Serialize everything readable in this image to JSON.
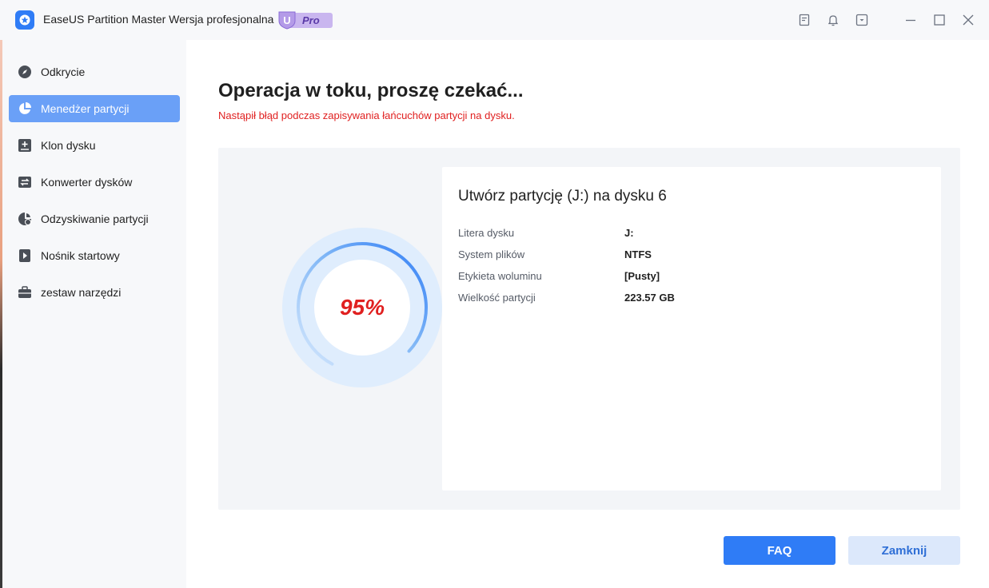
{
  "window": {
    "title": "EaseUS Partition Master Wersja profesjonalna",
    "badge_letter": "U",
    "badge_label": "Pro",
    "controls": [
      "notes-icon",
      "bell-icon",
      "dropdown-box-icon",
      "minimize-icon",
      "maximize-icon",
      "close-icon"
    ]
  },
  "sidebar": {
    "items": [
      {
        "label": "Odkrycie",
        "icon": "compass-icon",
        "active": false
      },
      {
        "label": "Menedżer partycji",
        "icon": "pie-chart-icon",
        "active": true
      },
      {
        "label": "Klon dysku",
        "icon": "disk-clone-icon",
        "active": false
      },
      {
        "label": "Konwerter dysków",
        "icon": "disk-convert-icon",
        "active": false
      },
      {
        "label": "Odzyskiwanie partycji",
        "icon": "partition-recovery-icon",
        "active": false
      },
      {
        "label": "Nośnik startowy",
        "icon": "bootable-media-icon",
        "active": false
      },
      {
        "label": "zestaw narzędzi",
        "icon": "toolbox-icon",
        "active": false
      }
    ]
  },
  "main": {
    "heading": "Operacja w toku, proszę czekać...",
    "error": "Nastąpił błąd podczas zapisywania łańcuchów partycji na dysku.",
    "progress": {
      "percent": 95,
      "label": "95%"
    },
    "operation": {
      "title": "Utwórz partycję (J:) na dysku 6",
      "details": [
        {
          "key": "Litera dysku",
          "value": "J:"
        },
        {
          "key": "System plików",
          "value": "NTFS"
        },
        {
          "key": "Etykieta woluminu",
          "value": "[Pusty]"
        },
        {
          "key": "Wielkość partycji",
          "value": "223.57 GB"
        }
      ]
    },
    "buttons": {
      "faq": "FAQ",
      "close": "Zamknij"
    }
  },
  "colors": {
    "accent": "#2f7cf6",
    "active_nav": "#6aa0f7",
    "error": "#e02020",
    "panel_bg": "#f3f5f8",
    "badge": "#c9b6ef"
  }
}
